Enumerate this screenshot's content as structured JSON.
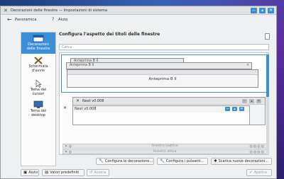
{
  "window": {
    "title": "Decorazioni delle finestre — Impostazioni di sistema",
    "app_icon": "system-settings-icon",
    "controls": {
      "minimize": "−",
      "maximize": "▴",
      "close": "✕"
    }
  },
  "navbar": {
    "back_glyph": "←",
    "overview_label": "Panoramica",
    "help_label": "Aiuto"
  },
  "sidebar": {
    "items": [
      {
        "label_line1": "Decorazioni",
        "label_line2": "delle finestre",
        "icon": "window-decorations-icon",
        "active": true
      },
      {
        "label_line1": "Schermata",
        "label_line2": "d'avvio",
        "icon": "splash-screen-icon",
        "active": false
      },
      {
        "label_line1": "Tema dei",
        "label_line2": "cursori",
        "icon": "cursor-theme-icon",
        "active": false
      },
      {
        "label_line1": "Tema del",
        "label_line2": "desktop",
        "icon": "desktop-theme-icon",
        "active": false
      }
    ]
  },
  "content": {
    "header": "Configura l'aspetto dei titoli delle finestre",
    "search_placeholder": "Cerca",
    "decorations": [
      {
        "preview_title": "Anteprima B II"
      },
      {
        "back_title": "Next v0.008",
        "front_title": "Next v0.008"
      },
      {
        "inactive_title": "Finestra inattiva",
        "active_title": "Finestra attiva"
      }
    ],
    "buttons": {
      "configure_decoration": "Configura la decorazione...",
      "configure_buttons": "Configura i pulsanti...",
      "get_new": "Scarica nuove decorazioni..."
    }
  },
  "footer": {
    "help": "Aiuto",
    "defaults": "Valori predefiniti",
    "reset": "Azzera",
    "apply": "Applica"
  },
  "colors": {
    "accent": "#3a8fd8",
    "window_bg": "#eff0f1"
  }
}
